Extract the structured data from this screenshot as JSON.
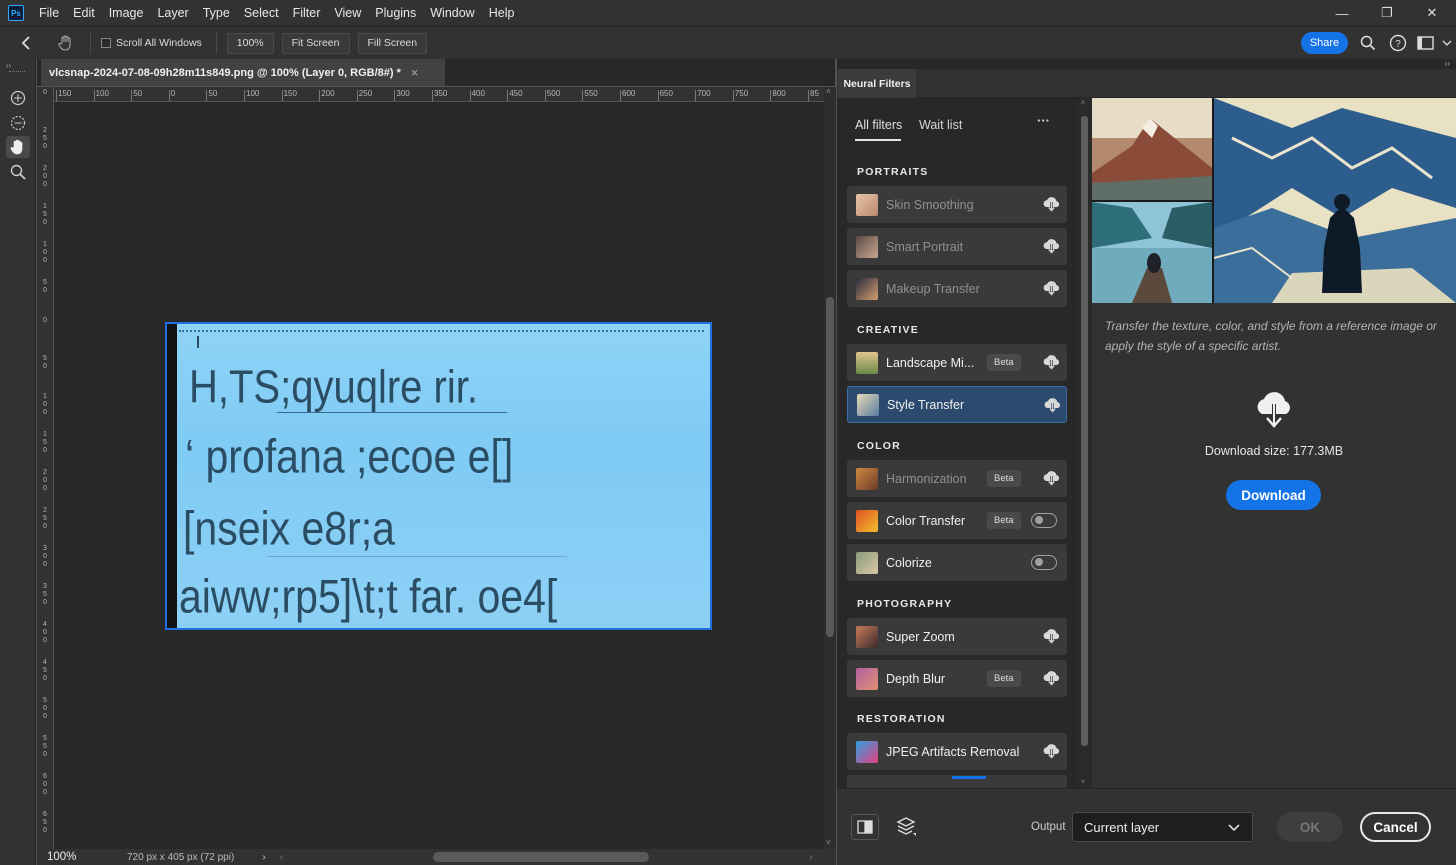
{
  "app": {
    "logo": "Ps"
  },
  "menu": [
    "File",
    "Edit",
    "Image",
    "Layer",
    "Type",
    "Select",
    "Filter",
    "View",
    "Plugins",
    "Window",
    "Help"
  ],
  "window_controls": {
    "minimize": "—",
    "restore": "❐",
    "close": "✕"
  },
  "options": {
    "scroll_all_windows": "Scroll All Windows",
    "zoom_btn": "100%",
    "fit_screen": "Fit Screen",
    "fill_screen": "Fill Screen",
    "share": "Share"
  },
  "document": {
    "tab_title": "vlcsnap-2024-07-08-09h28m11s849.png @ 100% (Layer 0, RGB/8#) *",
    "close_glyph": "×",
    "zoom": "100%",
    "info": "720 px x 405 px (72 ppi)",
    "info_arrow": "›",
    "scroll_left": "‹",
    "scroll_right": "›",
    "scroll_up": "˄",
    "scroll_down": "˅"
  },
  "ruler_h": [
    "150",
    "100",
    "50",
    "0",
    "50",
    "100",
    "150",
    "200",
    "250",
    "300",
    "350",
    "400",
    "450",
    "500",
    "550",
    "600",
    "650",
    "700",
    "750",
    "800",
    "85"
  ],
  "ruler_v": [
    "0",
    "2\n5\n0",
    "2\n0\n0",
    "1\n5\n0",
    "1\n0\n0",
    "5\n0",
    "0",
    "5\n0",
    "1\n0\n0",
    "1\n5\n0",
    "2\n0\n0",
    "2\n5\n0",
    "3\n0\n0",
    "3\n5\n0",
    "4\n0\n0",
    "4\n5\n0",
    "5\n0\n0",
    "5\n5\n0",
    "6\n0\n0",
    "6\n5\n0"
  ],
  "image_text": [
    "H,TS;qyuqlre rir.",
    "‘ profana ;ecoe e[]",
    "[nseix e8r;a",
    "aiww;rp5]\\t;t far. oe4["
  ],
  "neural_filters": {
    "panel_title": "Neural Filters",
    "tabs": {
      "all": "All filters",
      "wait": "Wait list"
    },
    "more": "···",
    "sections": [
      {
        "title": "PORTRAITS",
        "items": [
          {
            "label": "Skin Smoothing",
            "dim": true,
            "badge": "",
            "control": "cloud"
          },
          {
            "label": "Smart Portrait",
            "dim": true,
            "badge": "",
            "control": "cloud"
          },
          {
            "label": "Makeup Transfer",
            "dim": true,
            "badge": "",
            "control": "cloud"
          }
        ]
      },
      {
        "title": "CREATIVE",
        "items": [
          {
            "label": "Landscape Mi...",
            "dim": false,
            "badge": "Beta",
            "control": "cloud"
          },
          {
            "label": "Style Transfer",
            "dim": false,
            "badge": "",
            "control": "cloud",
            "selected": true
          }
        ]
      },
      {
        "title": "COLOR",
        "items": [
          {
            "label": "Harmonization",
            "dim": true,
            "badge": "Beta",
            "control": "cloud"
          },
          {
            "label": "Color Transfer",
            "dim": false,
            "badge": "Beta",
            "control": "toggle"
          },
          {
            "label": "Colorize",
            "dim": false,
            "badge": "",
            "control": "toggle"
          }
        ]
      },
      {
        "title": "PHOTOGRAPHY",
        "items": [
          {
            "label": "Super Zoom",
            "dim": false,
            "badge": "",
            "control": "cloud"
          },
          {
            "label": "Depth Blur",
            "dim": false,
            "badge": "Beta",
            "control": "cloud"
          }
        ]
      },
      {
        "title": "RESTORATION",
        "items": [
          {
            "label": "JPEG Artifacts Removal",
            "dim": false,
            "badge": "",
            "control": "cloud"
          }
        ]
      }
    ],
    "description": "Transfer the texture, color, and style from a reference image or apply the style of a specific artist.",
    "download_size": "Download size: 177.3MB",
    "download": "Download",
    "output_label": "Output",
    "output_value": "Current layer",
    "ok": "OK",
    "cancel": "Cancel"
  },
  "colors": {
    "accent": "#1473e6",
    "selection": "#2c4a6e",
    "panel": "#323232",
    "canvas_bg": "#282828"
  }
}
